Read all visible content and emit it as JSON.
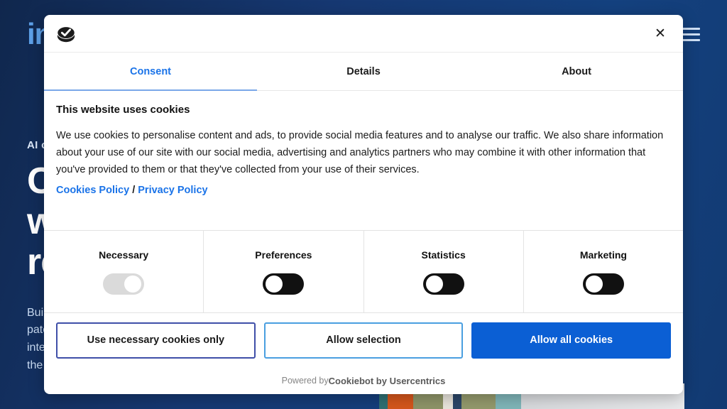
{
  "background_page": {
    "brand_logo_text": "in",
    "menu_icon": "hamburger-icon",
    "hero": {
      "eyebrow": "AI c",
      "title_line_1": "Co",
      "title_line_2": "w",
      "title_line_3": "re",
      "body_line_1": "Buil",
      "body_line_2": "pate",
      "body_line_3": "inte",
      "body_line_4": "the"
    }
  },
  "dialog": {
    "logo_icon": "cookiebot-logo-icon",
    "close_icon": "✕",
    "tabs": [
      {
        "label": "Consent",
        "active": true
      },
      {
        "label": "Details",
        "active": false
      },
      {
        "label": "About",
        "active": false
      }
    ],
    "heading": "This website uses cookies",
    "description": "We use cookies to personalise content and ads, to provide social media features and to analyse our traffic. We also share information about your use of our site with our social media, advertising and analytics partners who may combine it with other information that you've provided to them or that they've collected from your use of their services.",
    "links": {
      "cookies_policy": "Cookies Policy",
      "separator": "/",
      "privacy_policy": "Privacy Policy"
    },
    "categories": [
      {
        "label": "Necessary",
        "state": "locked-on"
      },
      {
        "label": "Preferences",
        "state": "off"
      },
      {
        "label": "Statistics",
        "state": "off"
      },
      {
        "label": "Marketing",
        "state": "off"
      }
    ],
    "buttons": {
      "necessary_only": "Use necessary cookies only",
      "allow_selection": "Allow selection",
      "allow_all": "Allow all cookies"
    },
    "footer": {
      "prefix": "Powered by ",
      "brand": "Cookiebot by Usercentrics"
    }
  },
  "colors": {
    "accent_blue": "#0b5fd4",
    "link_blue": "#1a73e8",
    "tab_underline": "#7aa7e8",
    "toggle_on_bg": "#111111",
    "toggle_locked_bg": "#dadada",
    "page_navy": "#14417f"
  }
}
